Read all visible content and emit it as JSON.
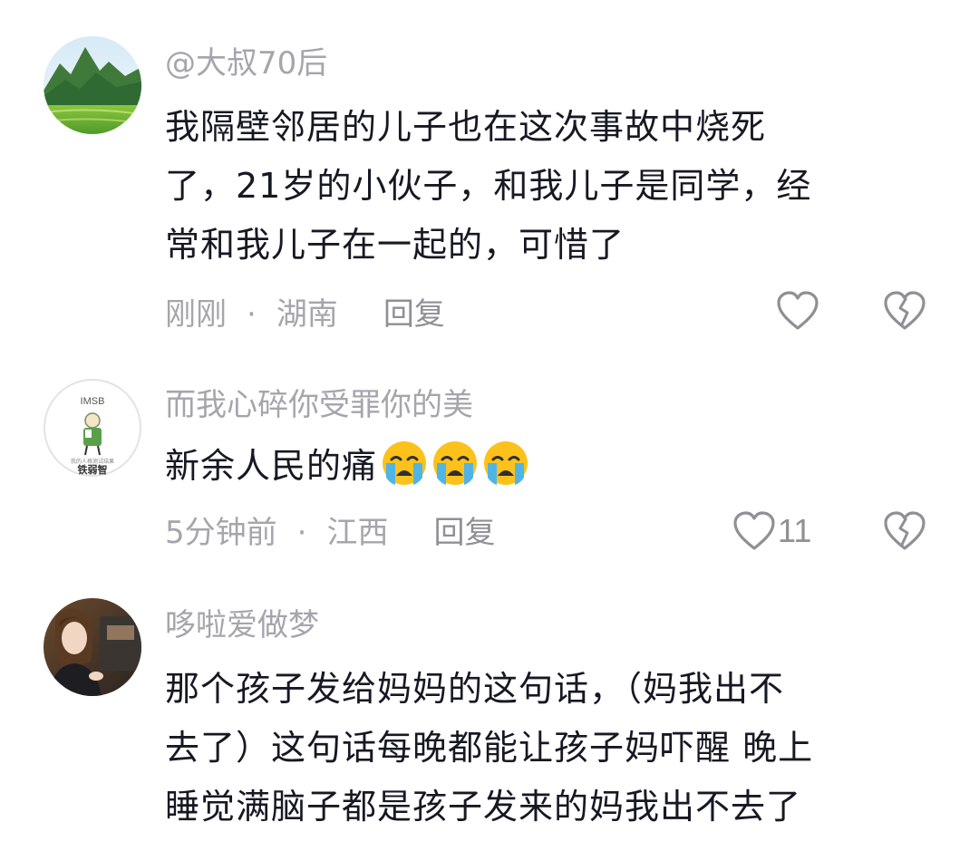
{
  "comments": [
    {
      "username": "@大叔70后",
      "lines": [
        "我隔壁邻居的儿子也在这次事故中烧死",
        "了，21岁的小伙子，和我儿子是同学，经",
        "常和我儿子在一起的，可惜了"
      ],
      "time": "刚刚",
      "location": "湖南",
      "reply_label": "回复",
      "like_count": "",
      "avatar_icon": "landscape-avatar"
    },
    {
      "username": "而我心碎你受罪你的美",
      "lines": [
        "新余人民的痛"
      ],
      "emojis": [
        "crying-face-emoji",
        "crying-face-emoji",
        "crying-face-emoji"
      ],
      "time": "5分钟前",
      "location": "江西",
      "reply_label": "回复",
      "like_count": "11",
      "avatar_top_text": "IMSB",
      "avatar_bottom_text": "铁弱智",
      "avatar_small_text": "我的人格测试结果"
    },
    {
      "username": "哆啦爱做梦",
      "lines": [
        "那个孩子发给妈妈的这句话，（妈我出不",
        "去了）这句话每晚都能让孩子妈吓醒 晚上",
        "睡觉满脑子都是孩子发来的妈我出不去了"
      ],
      "avatar_icon": "portrait-avatar"
    }
  ],
  "separator": "·",
  "colors": {
    "text": "#161823",
    "meta": "#a4a6ab",
    "icon": "#8e9096"
  }
}
